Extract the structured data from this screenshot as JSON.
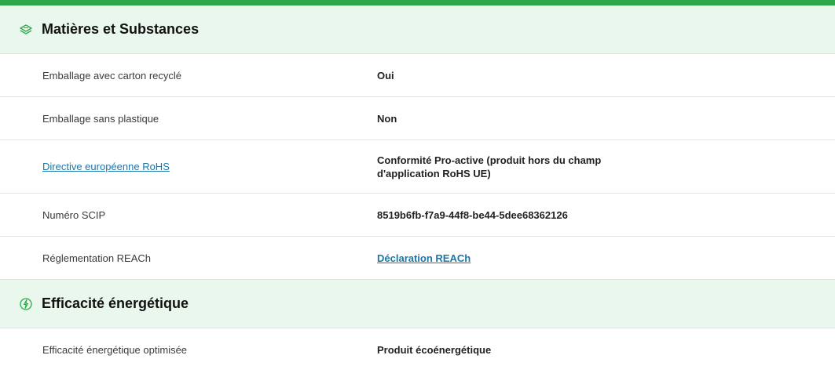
{
  "colors": {
    "accent": "#2ea84a",
    "header_bg": "#e9f7ec",
    "link": "#1a77a8"
  },
  "sections": [
    {
      "title": "Matières et Substances",
      "icon": "layers-leaf-icon",
      "rows": [
        {
          "label": "Emballage avec carton recyclé",
          "value": "Oui"
        },
        {
          "label": "Emballage sans plastique",
          "value": "Non"
        },
        {
          "label": "Directive européenne RoHS",
          "value": "Conformité Pro-active (produit hors du champ d'application RoHS UE)"
        },
        {
          "label": "Numéro SCIP",
          "value": "8519b6fb-f7a9-44f8-be44-5dee68362126"
        },
        {
          "label": "Réglementation REACh",
          "value": "Déclaration REACh"
        }
      ]
    },
    {
      "title": "Efficacité énergétique",
      "icon": "energy-leaf-icon",
      "rows": [
        {
          "label": "Efficacité énergétique optimisée",
          "value": "Produit écoénergétique"
        }
      ]
    }
  ]
}
